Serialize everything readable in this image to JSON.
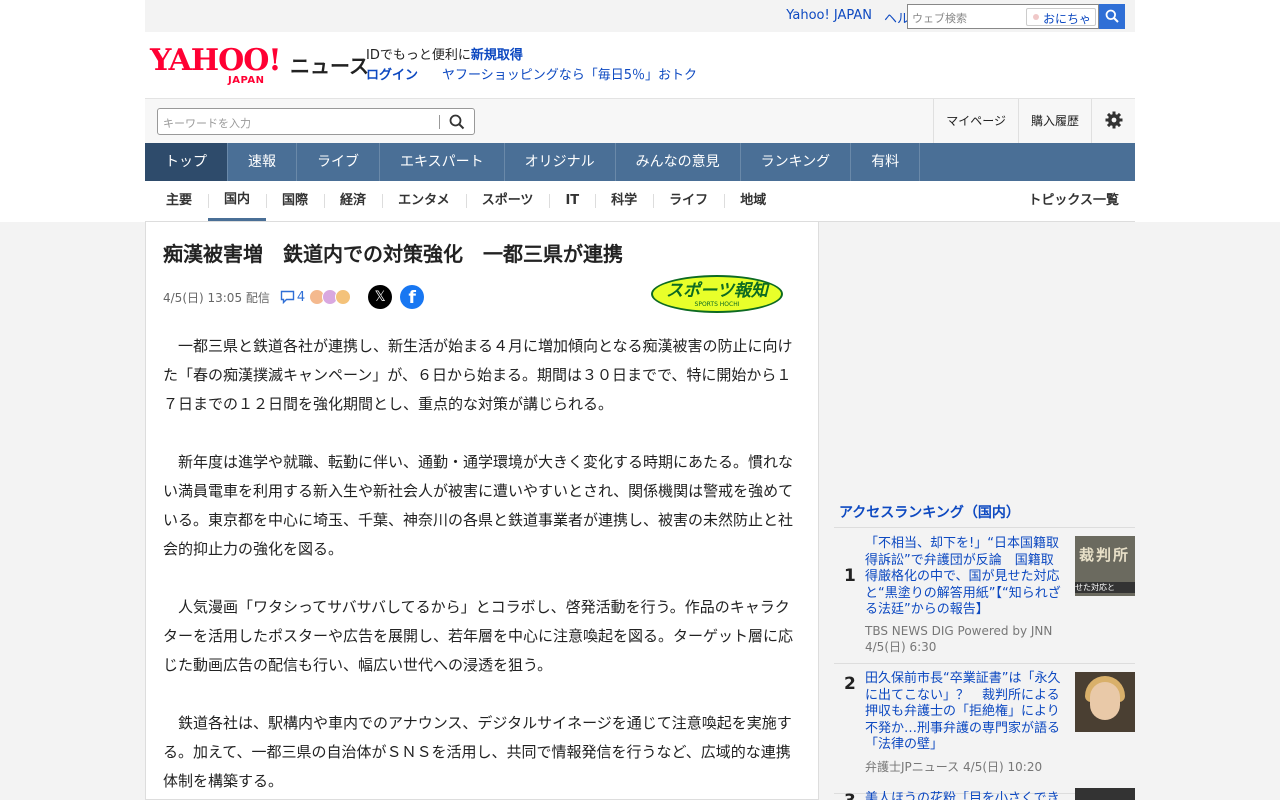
{
  "util": {
    "yahoo_japan_link": "Yahoo! JAPAN",
    "help_link": "ヘルプ",
    "web_search_placeholder": "ウェブ検索",
    "suggest_label": "おにちゃ"
  },
  "header": {
    "logo_text": "YAHOO!",
    "logo_sub": "JAPAN",
    "service_name": "ニュース",
    "promo_line1_prefix": "IDでもっと便利に",
    "promo_line1_link": "新規取得",
    "login_link": "ログイン",
    "shopping_promo": "ヤフーショッピングなら「毎日5％」おトク"
  },
  "search": {
    "keyword_placeholder": "キーワードを入力",
    "mypage": "マイページ",
    "history": "購入履歴"
  },
  "nav": {
    "items": [
      "トップ",
      "速報",
      "ライブ",
      "エキスパート",
      "オリジナル",
      "みんなの意見",
      "ランキング",
      "有料"
    ],
    "active_index": 0
  },
  "subnav": {
    "items": [
      "主要",
      "国内",
      "国際",
      "経済",
      "エンタメ",
      "スポーツ",
      "IT",
      "科学",
      "ライフ",
      "地域"
    ],
    "selected_index": 1,
    "topics_link": "トピックス一覧"
  },
  "article": {
    "headline": "痴漢被害増　鉄道内での対策強化　一都三県が連携",
    "published": "4/5(日) 13:05 配信",
    "comment_count": "4",
    "source_logo_text": "スポーツ報知",
    "source_logo_sub": "SPORTS HOCHI",
    "paragraphs": [
      "一都三県と鉄道各社が連携し、新生活が始まる４月に増加傾向となる痴漢被害の防止に向けた「春の痴漢撲滅キャンペーン」が、６日から始まる。期間は３０日までで、特に開始から１７日までの１２日間を強化期間とし、重点的な対策が講じられる。",
      "新年度は進学や就職、転勤に伴い、通勤・通学環境が大きく変化する時期にあたる。慣れない満員電車を利用する新入生や新社会人が被害に遭いやすいとされ、関係機関は警戒を強めている。東京都を中心に埼玉、千葉、神奈川の各県と鉄道事業者が連携し、被害の未然防止と社会的抑止力の強化を図る。",
      "人気漫画「ワタシってサバサバしてるから」とコラボし、啓発活動を行う。作品のキャラクターを活用したポスターや広告を展開し、若年層を中心に注意喚起を図る。ターゲット層に応じた動画広告の配信も行い、幅広い世代への浸透を狙う。",
      "鉄道各社は、駅構内や車内でのアナウンス、デジタルサイネージを通じて注意喚起を実施する。加えて、一都三県の自治体がＳＮＳを活用し、共同で情報発信を行うなど、広域的な連携体制を構築する。"
    ]
  },
  "ranking": {
    "title": "アクセスランキング（国内）",
    "items": [
      {
        "rank": "1",
        "title": "「不相当、却下を!」“日本国籍取得訴訟”で弁護団が反論　国籍取得厳格化の中で、国が見せた対応と“黒塗りの解答用紙”【“知られざる法廷”からの報告】",
        "source": "TBS NEWS DIG Powered by JNN",
        "time": "4/5(日) 6:30",
        "thumb_text": "裁判所",
        "thumb_caption": "せた対応と"
      },
      {
        "rank": "2",
        "title": "田久保前市長“卒業証書”は「永久に出てこない」？　裁判所による押収も弁護士の「拒絶権」により不発か…刑事弁護の専門家が語る「法律の壁」",
        "source": "弁護士JPニュース",
        "time": "4/5(日) 10:20"
      },
      {
        "rank": "3",
        "title": "美人ほうの花粉「目を小さくでき"
      }
    ]
  },
  "colors": {
    "link_blue": "#0d49c1",
    "nav_bg": "#4a6f96",
    "nav_active": "#2e4b6b",
    "yahoo_red": "#ff0033"
  }
}
